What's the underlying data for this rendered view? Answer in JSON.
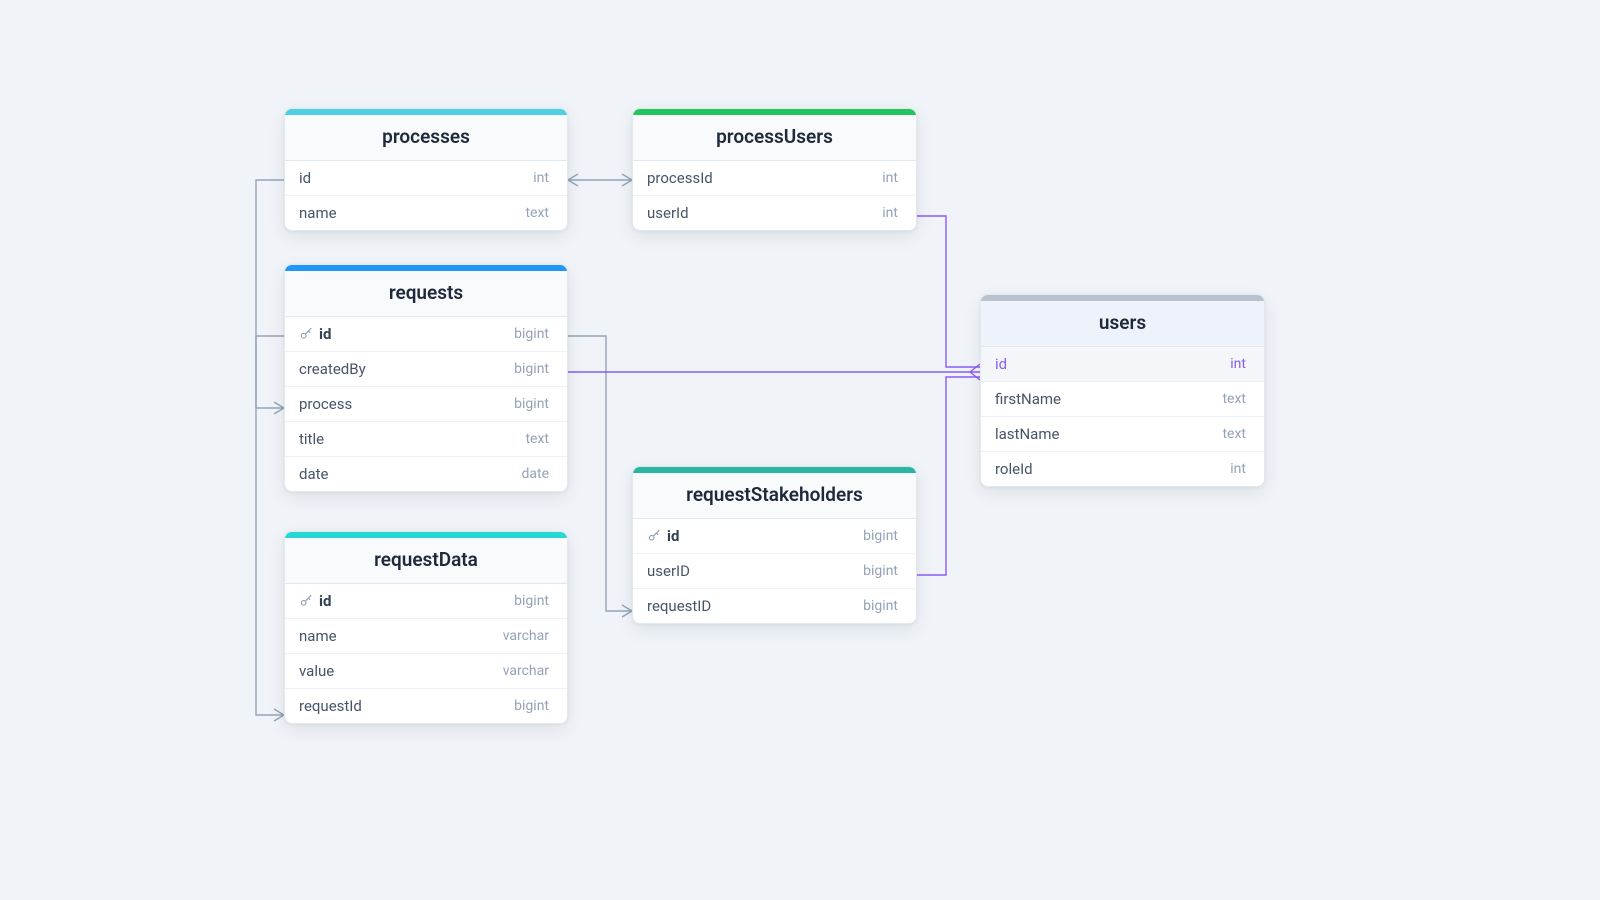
{
  "colors": {
    "stripe_processes": "#4dd0e1",
    "stripe_processUsers": "#22c55e",
    "stripe_requests": "#2196f3",
    "stripe_requestStakeholders": "#2bb6a3",
    "stripe_requestData": "#26d7d3",
    "stripe_users": "#b9c2cc",
    "wire_gray": "#94a3b8",
    "wire_purple": "#8b5cf6"
  },
  "tables": {
    "processes": {
      "title": "processes",
      "rows": [
        {
          "name": "id",
          "type": "int",
          "pk": false
        },
        {
          "name": "name",
          "type": "text",
          "pk": false
        }
      ]
    },
    "processUsers": {
      "title": "processUsers",
      "rows": [
        {
          "name": "processId",
          "type": "int",
          "pk": false
        },
        {
          "name": "userId",
          "type": "int",
          "pk": false
        }
      ]
    },
    "requests": {
      "title": "requests",
      "rows": [
        {
          "name": "id",
          "type": "bigint",
          "pk": true
        },
        {
          "name": "createdBy",
          "type": "bigint",
          "pk": false
        },
        {
          "name": "process",
          "type": "bigint",
          "pk": false
        },
        {
          "name": "title",
          "type": "text",
          "pk": false
        },
        {
          "name": "date",
          "type": "date",
          "pk": false
        }
      ]
    },
    "requestStakeholders": {
      "title": "requestStakeholders",
      "rows": [
        {
          "name": "id",
          "type": "bigint",
          "pk": true
        },
        {
          "name": "userID",
          "type": "bigint",
          "pk": false
        },
        {
          "name": "requestID",
          "type": "bigint",
          "pk": false
        }
      ]
    },
    "requestData": {
      "title": "requestData",
      "rows": [
        {
          "name": "id",
          "type": "bigint",
          "pk": true
        },
        {
          "name": "name",
          "type": "varchar",
          "pk": false
        },
        {
          "name": "value",
          "type": "varchar",
          "pk": false
        },
        {
          "name": "requestId",
          "type": "bigint",
          "pk": false
        }
      ]
    },
    "users": {
      "title": "users",
      "rows": [
        {
          "name": "id",
          "type": "int",
          "pk": false,
          "highlight": true
        },
        {
          "name": "firstName",
          "type": "text",
          "pk": false
        },
        {
          "name": "lastName",
          "type": "text",
          "pk": false
        },
        {
          "name": "roleId",
          "type": "int",
          "pk": false
        }
      ]
    }
  },
  "relations": [
    {
      "from": "processes.id",
      "to": "processUsers.processId",
      "color": "gray"
    },
    {
      "from": "processes.id",
      "to": "requests.process",
      "color": "gray"
    },
    {
      "from": "requests.id",
      "to": "requestStakeholders.requestID",
      "color": "gray"
    },
    {
      "from": "requests.id",
      "to": "requestData.requestId",
      "color": "gray"
    },
    {
      "from": "requests.createdBy",
      "to": "users.id",
      "color": "purple"
    },
    {
      "from": "processUsers.userId",
      "to": "users.id",
      "color": "purple"
    },
    {
      "from": "requestStakeholders.userID",
      "to": "users.id",
      "color": "purple"
    }
  ]
}
